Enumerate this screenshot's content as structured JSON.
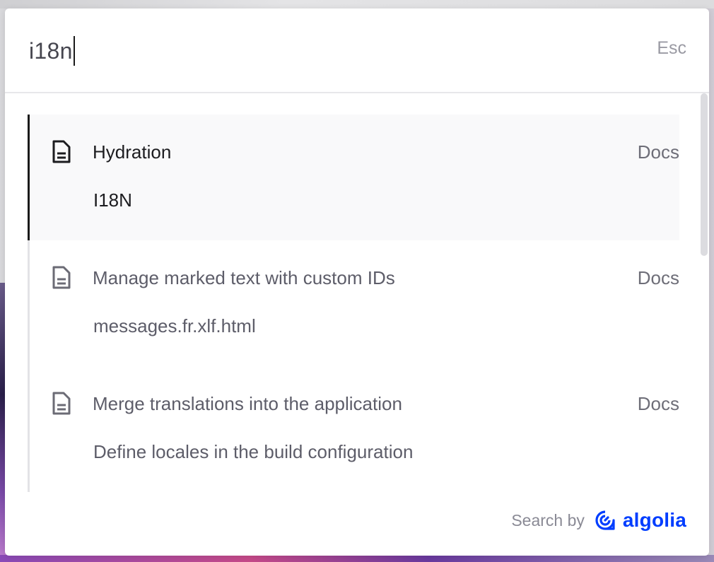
{
  "search": {
    "query": "i18n",
    "close_hint": "Esc"
  },
  "results": [
    {
      "title": "Hydration",
      "subtitle": "I18N",
      "tag": "Docs",
      "icon": "document-icon",
      "active": true
    },
    {
      "title": "Manage marked text with custom IDs",
      "subtitle": "messages.fr.xlf.html",
      "tag": "Docs",
      "icon": "document-icon",
      "active": false
    },
    {
      "title": "Merge translations into the application",
      "subtitle": "Define locales in the build configuration",
      "tag": "Docs",
      "icon": "document-icon",
      "active": false
    }
  ],
  "footer": {
    "label": "Search by",
    "brand": "algolia",
    "brand_color": "#003dff"
  },
  "colors": {
    "active_indicator": "#1a1a1a",
    "active_background": "#f9f9fa"
  }
}
